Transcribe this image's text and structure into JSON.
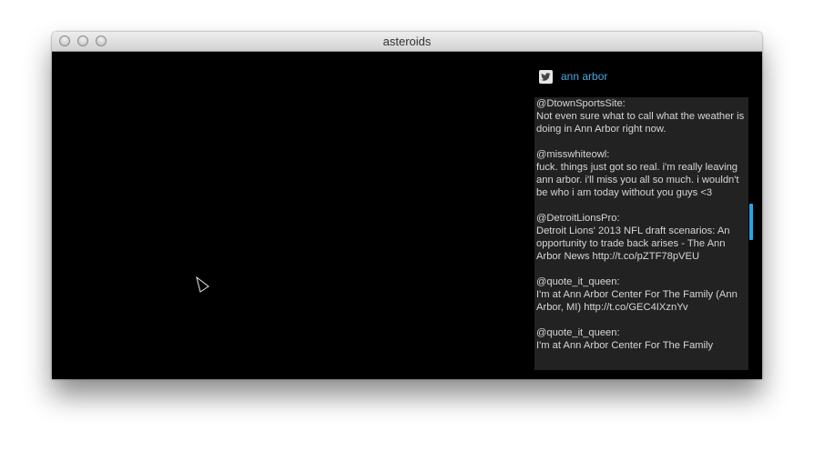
{
  "window": {
    "title": "asteroids"
  },
  "twitter": {
    "query": "ann arbor",
    "tweets": [
      {
        "user": "@DtownSportsSite:",
        "text": "Not even sure what to call what the weather is doing in Ann Arbor right now."
      },
      {
        "user": "@misswhiteowl:",
        "text": "fuck. things just got so real. i'm really leaving ann arbor. i'll miss you all so much. i wouldn't be who i am today without you guys <3"
      },
      {
        "user": "@DetroitLionsPro:",
        "text": "Detroit Lions' 2013 NFL draft scenarios: An opportunity to trade back arises - The Ann Arbor News http://t.co/pZTF78pVEU"
      },
      {
        "user": "@quote_it_queen:",
        "text": "I'm at Ann Arbor Center For The Family (Ann Arbor, MI) http://t.co/GEC4IXznYv"
      },
      {
        "user": "@quote_it_queen:",
        "text": "I'm at Ann Arbor Center For The Family"
      }
    ]
  },
  "colors": {
    "canvas_background": "#000000",
    "feed_background": "#222222",
    "feed_text": "#d6d6d6",
    "link_accent": "#4aa8e0",
    "scrollbar_accent": "#22a8e6"
  },
  "icons": {
    "ship": "ship-icon",
    "twitter": "twitter-bird-icon"
  }
}
